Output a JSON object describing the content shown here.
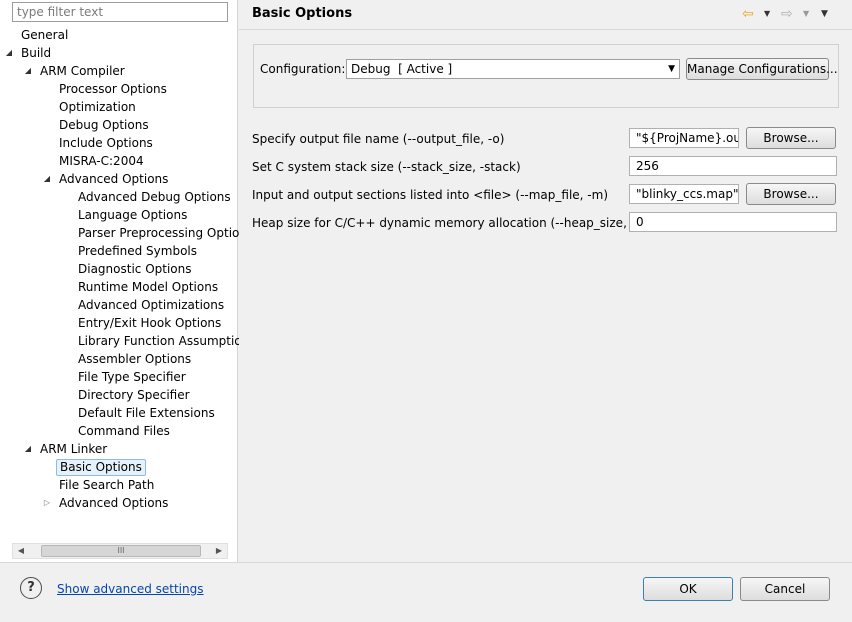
{
  "filter": {
    "placeholder": "type filter text"
  },
  "tree": {
    "items": [
      {
        "label": "General"
      },
      {
        "label": "Build"
      },
      {
        "label": "ARM Compiler"
      },
      {
        "label": "Processor Options"
      },
      {
        "label": "Optimization"
      },
      {
        "label": "Debug Options"
      },
      {
        "label": "Include Options"
      },
      {
        "label": "MISRA-C:2004"
      },
      {
        "label": "Advanced Options"
      },
      {
        "label": "Advanced Debug Options"
      },
      {
        "label": "Language Options"
      },
      {
        "label": "Parser Preprocessing Option"
      },
      {
        "label": "Predefined Symbols"
      },
      {
        "label": "Diagnostic Options"
      },
      {
        "label": "Runtime Model Options"
      },
      {
        "label": "Advanced Optimizations"
      },
      {
        "label": "Entry/Exit Hook Options"
      },
      {
        "label": "Library Function Assumptior"
      },
      {
        "label": "Assembler Options"
      },
      {
        "label": "File Type Specifier"
      },
      {
        "label": "Directory Specifier"
      },
      {
        "label": "Default File Extensions"
      },
      {
        "label": "Command Files"
      },
      {
        "label": "ARM Linker"
      },
      {
        "label": "Basic Options"
      },
      {
        "label": "File Search Path"
      },
      {
        "label": "Advanced Options"
      }
    ],
    "scroll_thumb": "III"
  },
  "page": {
    "title": "Basic Options"
  },
  "configuration": {
    "label": "Configuration:",
    "selected": "Debug  [ Active ]",
    "manage_label": "Manage Configurations..."
  },
  "options": [
    {
      "label": "Specify output file name (--output_file, -o)",
      "value": "\"${ProjName}.out\"",
      "browse": "Browse..."
    },
    {
      "label": "Set C system stack size (--stack_size, -stack)",
      "value": "256"
    },
    {
      "label": "Input and output sections listed into <file> (--map_file, -m)",
      "value": "\"blinky_ccs.map\"",
      "browse": "Browse..."
    },
    {
      "label": "Heap size for C/C++ dynamic memory allocation (--heap_size, -heap)",
      "value": "0"
    }
  ],
  "footer": {
    "help_glyph": "?",
    "advanced_link": "Show advanced settings",
    "ok_label": "OK",
    "cancel_label": "Cancel"
  },
  "colors": {
    "link": "#0645ad",
    "selection": "#e5f1fb",
    "nav_arrow": "#e8a81c"
  }
}
